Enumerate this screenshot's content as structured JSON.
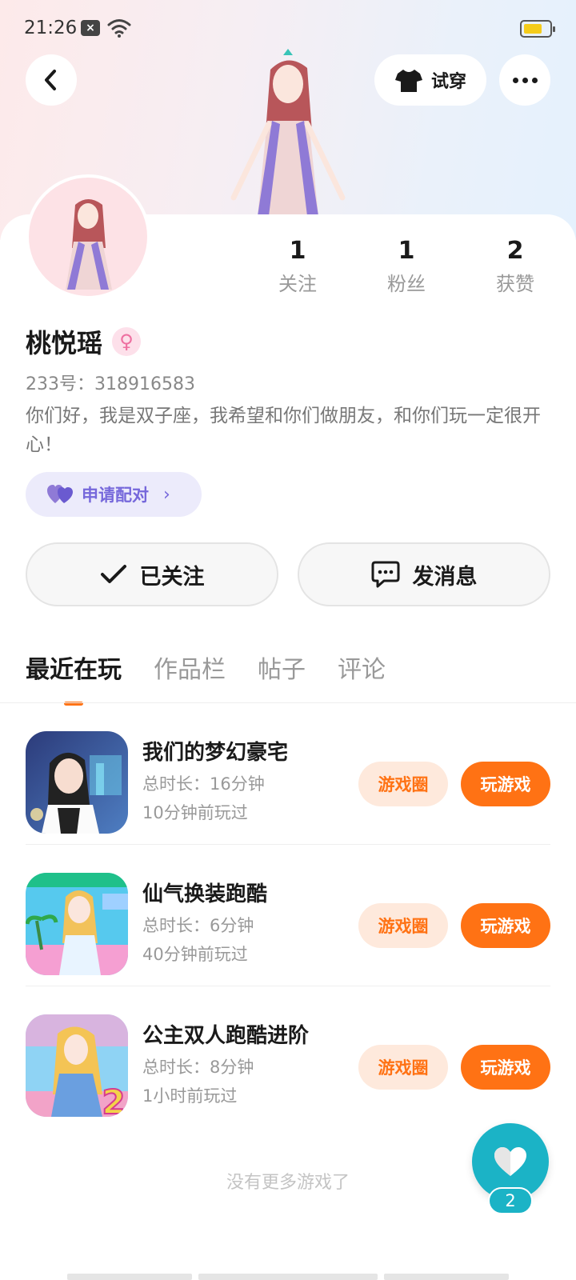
{
  "status_bar": {
    "time": "21:26",
    "notif_icon": "close-badge-icon",
    "wifi_icon": "wifi-icon",
    "battery_icon": "battery-icon",
    "battery_color": "#f5cc1a"
  },
  "header": {
    "back_icon": "back-arrow-icon",
    "try_on_label": "试穿",
    "try_on_icon": "tshirt-icon",
    "more_icon": "more-dots-icon"
  },
  "profile": {
    "stats": [
      {
        "num": "1",
        "label": "关注"
      },
      {
        "num": "1",
        "label": "粉丝"
      },
      {
        "num": "2",
        "label": "获赞"
      }
    ],
    "name": "桃悦瑶",
    "gender_icon": "female-icon",
    "uid": "233号：318916583",
    "bio": "你们好，我是双子座，我希望和你们做朋友，和你们玩一定很开心！",
    "pair_label": "申请配对",
    "follow_label": "已关注",
    "message_label": "发消息"
  },
  "tabs": [
    {
      "label": "最近在玩",
      "active": true
    },
    {
      "label": "作品栏",
      "active": false
    },
    {
      "label": "帖子",
      "active": false
    },
    {
      "label": "评论",
      "active": false
    }
  ],
  "games": [
    {
      "name": "我们的梦幻豪宅",
      "duration": "总时长：16分钟",
      "last_played": "10分钟前玩过",
      "circle_label": "游戏圈",
      "play_label": "玩游戏"
    },
    {
      "name": "仙气换装跑酷",
      "duration": "总时长：6分钟",
      "last_played": "40分钟前玩过",
      "circle_label": "游戏圈",
      "play_label": "玩游戏"
    },
    {
      "name": "公主双人跑酷进阶",
      "duration": "总时长：8分钟",
      "last_played": "1小时前玩过",
      "circle_label": "游戏圈",
      "play_label": "玩游戏"
    }
  ],
  "footer": {
    "no_more": "没有更多游戏了"
  },
  "like_fab": {
    "count": "2",
    "icon": "heart-icon"
  },
  "colors": {
    "accent": "#ff7214",
    "pair": "#7668db",
    "fab": "#1bb3c6"
  }
}
